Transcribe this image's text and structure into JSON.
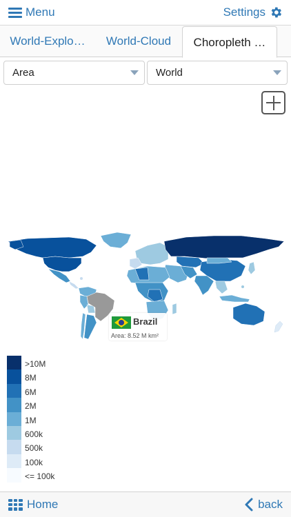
{
  "topbar": {
    "menu_label": "Menu",
    "settings_label": "Settings"
  },
  "tabs": [
    {
      "label": "World-Explo…",
      "active": false
    },
    {
      "label": "World-Cloud",
      "active": false
    },
    {
      "label": "Choropleth …",
      "active": true
    }
  ],
  "filters": {
    "metric": "Area",
    "region": "World"
  },
  "tooltip": {
    "country": "Brazil",
    "area_text": "Area: 8.52 M km²"
  },
  "legend": [
    {
      "label": ">10M",
      "color": "#08306b"
    },
    {
      "label": "8M",
      "color": "#08519c"
    },
    {
      "label": "6M",
      "color": "#2171b5"
    },
    {
      "label": "2M",
      "color": "#4292c6"
    },
    {
      "label": "1M",
      "color": "#6baed6"
    },
    {
      "label": "600k",
      "color": "#9ecae1"
    },
    {
      "label": "500k",
      "color": "#c6dbef"
    },
    {
      "label": "100k",
      "color": "#deebf7"
    },
    {
      "label": "<= 100k",
      "color": "#f7fbff"
    }
  ],
  "bottombar": {
    "home_label": "Home",
    "back_label": "back"
  },
  "colors": {
    "accent": "#2f78b5",
    "selected_country": "#999999"
  }
}
